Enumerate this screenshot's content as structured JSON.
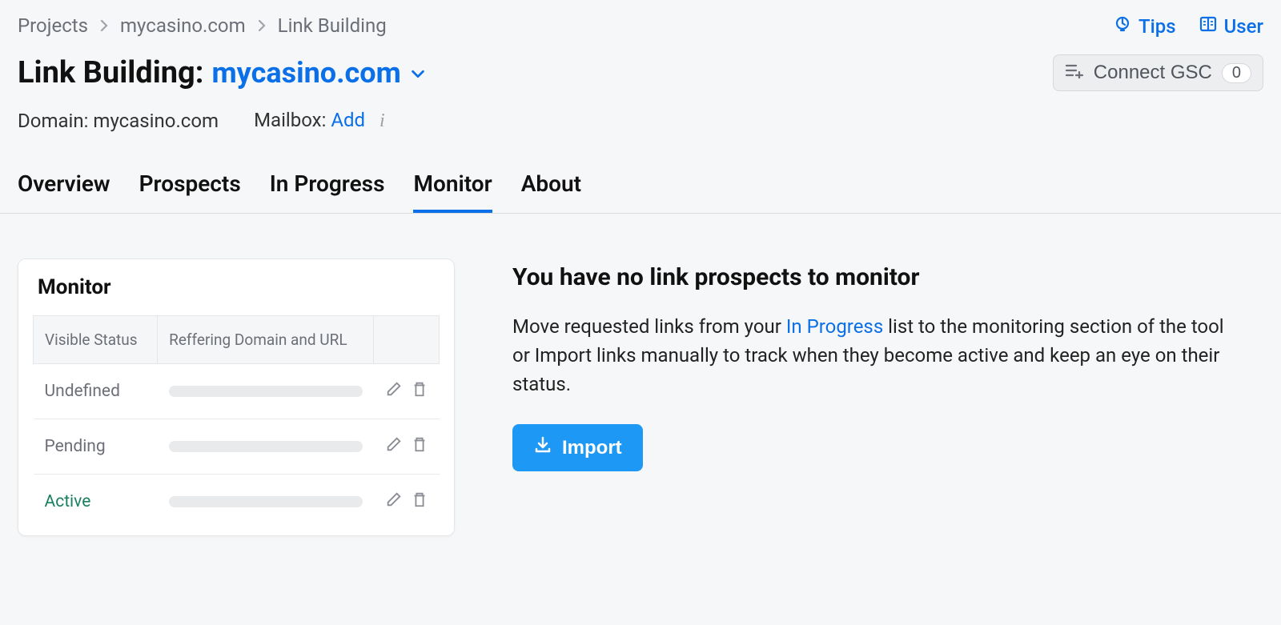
{
  "breadcrumb": {
    "items": [
      "Projects",
      "mycasino.com",
      "Link Building"
    ]
  },
  "top_links": {
    "tips": "Tips",
    "user": "User"
  },
  "title": {
    "prefix": "Link Building:",
    "project": "mycasino.com"
  },
  "connect_gsc": {
    "label": "Connect GSC",
    "count": "0"
  },
  "subline": {
    "domain_label": "Domain:",
    "domain_value": "mycasino.com",
    "mailbox_label": "Mailbox:",
    "add": "Add"
  },
  "tabs": [
    "Overview",
    "Prospects",
    "In Progress",
    "Monitor",
    "About"
  ],
  "active_tab": "Monitor",
  "monitor_card": {
    "title": "Monitor",
    "columns": [
      "Visible Status",
      "Reffering Domain and URL"
    ],
    "rows": [
      {
        "status": "Undefined",
        "active": false
      },
      {
        "status": "Pending",
        "active": false
      },
      {
        "status": "Active",
        "active": true
      }
    ]
  },
  "empty": {
    "heading": "You have no link prospects to monitor",
    "text_before": "Move requested links from your ",
    "link_text": "In Progress",
    "text_after": " list to the monitoring section of the tool or Import links manually to track when they become active and keep an eye on their status.",
    "import": "Import"
  }
}
